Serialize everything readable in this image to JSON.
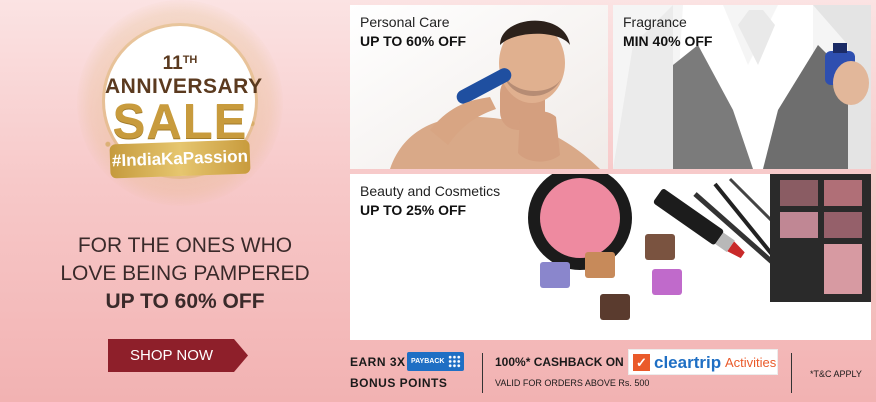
{
  "badge": {
    "anniv_num": "11",
    "anniv_suffix": "TH",
    "anniv_label": "ANNIVERSARY",
    "sale": "SALE",
    "hashtag": "#IndiaKaPassion"
  },
  "promo": {
    "line1": "FOR THE ONES WHO",
    "line2": "LOVE BEING PAMPERED",
    "line3": "UP TO 60% OFF",
    "cta": "SHOP NOW"
  },
  "tiles": {
    "personal": {
      "title": "Personal Care",
      "offer": "UP TO 60% OFF"
    },
    "fragrance": {
      "title": "Fragrance",
      "offer": "MIN 40% OFF"
    },
    "beauty": {
      "title": "Beauty and Cosmetics",
      "offer": "UP TO 25% OFF"
    }
  },
  "footer": {
    "earn": "EARN  3X",
    "bonus": "BONUS POINTS",
    "payback_logo": "PAYBACK",
    "cashback": "100%* CASHBACK ON",
    "valid": "VALID FOR ORDERS ABOVE Rs. 500",
    "partner_icon_letter": "✓",
    "partner_name": "cleartrip",
    "partner_suffix": "Activities",
    "terms": "*T&C APPLY"
  },
  "colors": {
    "accent_maroon": "#8e1f2a",
    "gold": "#c89b3d",
    "payback_blue": "#1f6fc4",
    "cleartrip_orange": "#ea5a2a"
  }
}
